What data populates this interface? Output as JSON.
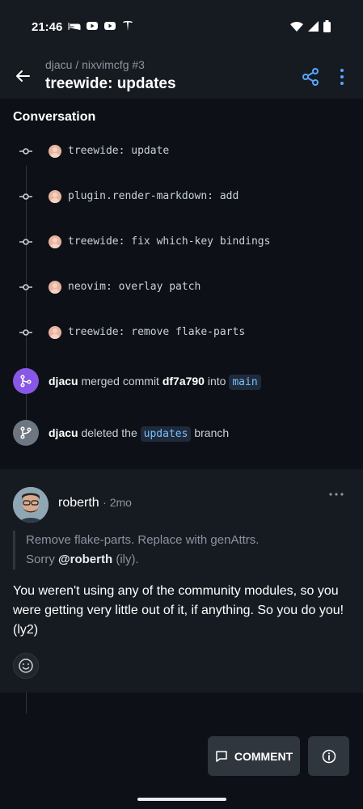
{
  "status_bar": {
    "time": "21:46"
  },
  "header": {
    "repo": "djacu / nixvimcfg #3",
    "title": "treewide: updates"
  },
  "conversation": {
    "title": "Conversation",
    "commits": [
      {
        "message": "treewide: update"
      },
      {
        "message": "plugin.render-markdown: add"
      },
      {
        "message": "treewide: fix which-key bindings"
      },
      {
        "message": "neovim: overlay patch"
      },
      {
        "message": "treewide: remove flake-parts"
      }
    ],
    "merge_event": {
      "actor": "djacu",
      "text1": "merged commit",
      "commit": "df7a790",
      "text2": "into",
      "branch": "main",
      "color": "#8957e5"
    },
    "delete_event": {
      "actor": "djacu",
      "text1": "deleted the",
      "branch": "updates",
      "text2": "branch",
      "color": "#6e7681"
    }
  },
  "comment": {
    "author": "roberth",
    "time": "· 2mo",
    "quote_line1": "Remove flake-parts. Replace with genAttrs.",
    "quote_sorry": "Sorry",
    "quote_mention": "@roberth",
    "quote_rest": "(ily).",
    "body": "You weren't using any of the community modules, so you were getting very little out of it, if anything. So you do you! (ly2)"
  },
  "actions": {
    "comment_label": "COMMENT"
  },
  "colors": {
    "accent": "#58a6ff",
    "background": "#0d1117",
    "surface": "#161b22"
  }
}
